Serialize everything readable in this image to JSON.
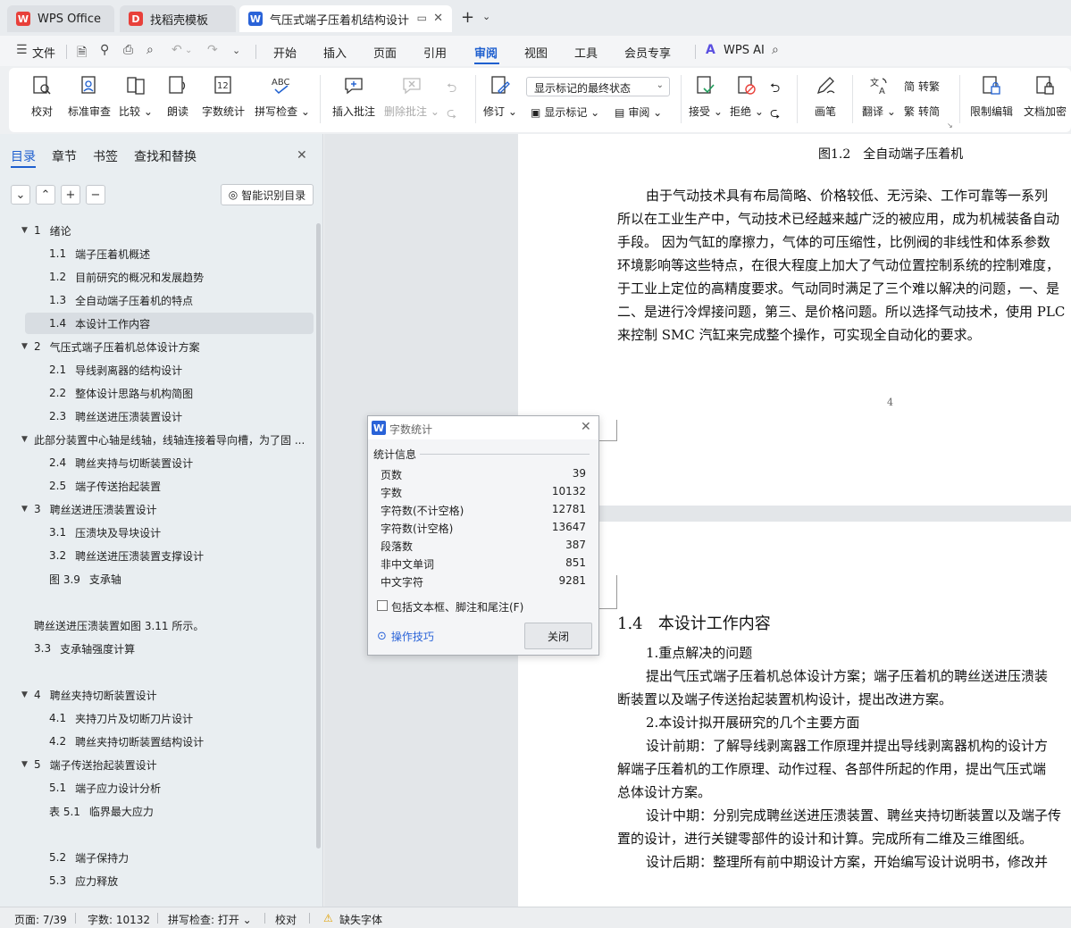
{
  "tabs": [
    {
      "label": "WPS Office",
      "icon": "wps-logo-icon"
    },
    {
      "label": "找稻壳模板",
      "icon": "docer-logo-icon"
    },
    {
      "label": "气压式端子压着机结构设计 说",
      "icon": "writer-logo-icon"
    }
  ],
  "menubar": {
    "file": "文件",
    "items": [
      "开始",
      "插入",
      "页面",
      "引用",
      "审阅",
      "视图",
      "工具",
      "会员专享"
    ],
    "active": "审阅",
    "ai": "WPS AI"
  },
  "ribbon": {
    "proofread": "校对",
    "standard_review": "标准审查",
    "compare": "比较",
    "read_aloud": "朗读",
    "word_count": "字数统计",
    "spell_check": "拼写检查",
    "insert_comment": "插入批注",
    "delete_comment": "删除批注",
    "revise": "修订",
    "markup_select": "显示标记的最终状态",
    "show_markup": "显示标记",
    "review": "审阅",
    "accept": "接受",
    "reject": "拒绝",
    "pen": "画笔",
    "translate": "翻译",
    "to_traditional": "转繁",
    "to_simplified": "转简",
    "restrict_edit": "限制编辑",
    "doc_encrypt": "文档加密"
  },
  "nav": {
    "tabs": [
      "目录",
      "章节",
      "书签",
      "查找和替换"
    ],
    "smart_toc": "智能识别目录",
    "toc": [
      {
        "num": "1",
        "text": "绪论",
        "level": 1,
        "expanded": true
      },
      {
        "num": "1.1",
        "text": "端子压着机概述",
        "level": 2
      },
      {
        "num": "1.2",
        "text": "目前研究的概况和发展趋势",
        "level": 2
      },
      {
        "num": "1.3",
        "text": "全自动端子压着机的特点",
        "level": 2
      },
      {
        "num": "1.4",
        "text": "本设计工作内容",
        "level": 2,
        "selected": true
      },
      {
        "num": "2",
        "text": "气压式端子压着机总体设计方案",
        "level": 1,
        "expanded": true
      },
      {
        "num": "2.1",
        "text": "导线剥离器的结构设计",
        "level": 2
      },
      {
        "num": "2.2",
        "text": "整体设计思路与机构简图",
        "level": 2
      },
      {
        "num": "2.3",
        "text": "聘丝送进压溃装置设计",
        "level": 2
      },
      {
        "num": "",
        "text": "此部分装置中心轴是线轴，线轴连接着导向槽，为了固 ...",
        "level": 1,
        "expanded": true
      },
      {
        "num": "2.4",
        "text": "聘丝夹持与切断装置设计",
        "level": 2
      },
      {
        "num": "2.5",
        "text": "端子传送抬起装置",
        "level": 2
      },
      {
        "num": "3",
        "text": "聘丝送进压溃装置设计",
        "level": 1,
        "expanded": true
      },
      {
        "num": "3.1",
        "text": "压溃块及导块设计",
        "level": 2
      },
      {
        "num": "3.2",
        "text": "聘丝送进压溃装置支撑设计",
        "level": 2
      },
      {
        "num": "图 3.9",
        "text": "支承轴",
        "level": 2
      },
      {
        "num": "",
        "text": "",
        "level": 2
      },
      {
        "num": "",
        "text": "聘丝送进压溃装置如图 3.11 所示。",
        "level": 0
      },
      {
        "num": "3.3",
        "text": "支承轴强度计算",
        "level": 0
      },
      {
        "num": "",
        "text": "",
        "level": 2
      },
      {
        "num": "4",
        "text": "聘丝夹持切断装置设计",
        "level": 1,
        "expanded": true
      },
      {
        "num": "4.1",
        "text": "夹持刀片及切断刀片设计",
        "level": 2
      },
      {
        "num": "4.2",
        "text": "聘丝夹持切断装置结构设计",
        "level": 2
      },
      {
        "num": "5",
        "text": "端子传送抬起装置设计",
        "level": 1,
        "expanded": true
      },
      {
        "num": "5.1",
        "text": "端子应力设计分析",
        "level": 2
      },
      {
        "num": "表 5.1",
        "text": "临界最大应力",
        "level": 2
      },
      {
        "num": "",
        "text": "",
        "level": 2
      },
      {
        "num": "5.2",
        "text": "端子保持力",
        "level": 2
      },
      {
        "num": "5.3",
        "text": "应力释放",
        "level": 2
      }
    ]
  },
  "document": {
    "figure_caption": "图1.2　全自动端子压着机",
    "page1_lines": [
      "由于气动技术具有布局简略、价格较低、无污染、工作可靠等一系列",
      "所以在工业生产中，气动技术已经越来越广泛的被应用，成为机械装备自动",
      "手段。 因为气缸的摩擦力，气体的可压缩性，比例阀的非线性和体系参数",
      "环境影响等这些特点，在很大程度上加大了气动位置控制系统的控制难度，",
      "于工业上定位的高精度要求。气动同时满足了三个难以解决的问题，一、是",
      "二、是进行冷焊接问题，第三、是价格问题。所以选择气动技术，使用 PLC",
      "来控制 SMC 汽缸来完成整个操作，可实现全自动化的要求。"
    ],
    "page_number": "4",
    "section_heading_num": "1.4",
    "section_heading_text": "本设计工作内容",
    "page2_lines": [
      "1.重点解决的问题",
      "提出气压式端子压着机总体设计方案；端子压着机的聘丝送进压溃装",
      "断装置以及端子传送抬起装置机构设计，提出改进方案。",
      "2.本设计拟开展研究的几个主要方面",
      "设计前期：了解导线剥离器工作原理并提出导线剥离器机构的设计方",
      "解端子压着机的工作原理、动作过程、各部件所起的作用，提出气压式端",
      "总体设计方案。",
      "设计中期：分别完成聘丝送进压溃装置、聘丝夹持切断装置以及端子传",
      "置的设计，进行关键零部件的设计和计算。完成所有二维及三维图纸。",
      "设计后期：整理所有前中期设计方案，开始编写设计说明书，修改并"
    ]
  },
  "dialog": {
    "title": "字数统计",
    "group": "统计信息",
    "stats": [
      {
        "label": "页数",
        "value": "39"
      },
      {
        "label": "字数",
        "value": "10132"
      },
      {
        "label": "字符数(不计空格)",
        "value": "12781"
      },
      {
        "label": "字符数(计空格)",
        "value": "13647"
      },
      {
        "label": "段落数",
        "value": "387"
      },
      {
        "label": "非中文单词",
        "value": "851"
      },
      {
        "label": "中文字符",
        "value": "9281"
      }
    ],
    "include_label": "包括文本框、脚注和尾注(F)",
    "tips": "操作技巧",
    "close": "关闭"
  },
  "status": {
    "page": "页面: 7/39",
    "word_count": "字数: 10132",
    "spell_check": "拼写检查: 打开",
    "proofread": "校对",
    "missing_font": "缺失字体"
  },
  "colors": {
    "accent": "#1e5fcf",
    "wps_red": "#e8403a",
    "writer_blue": "#2a63d8"
  }
}
